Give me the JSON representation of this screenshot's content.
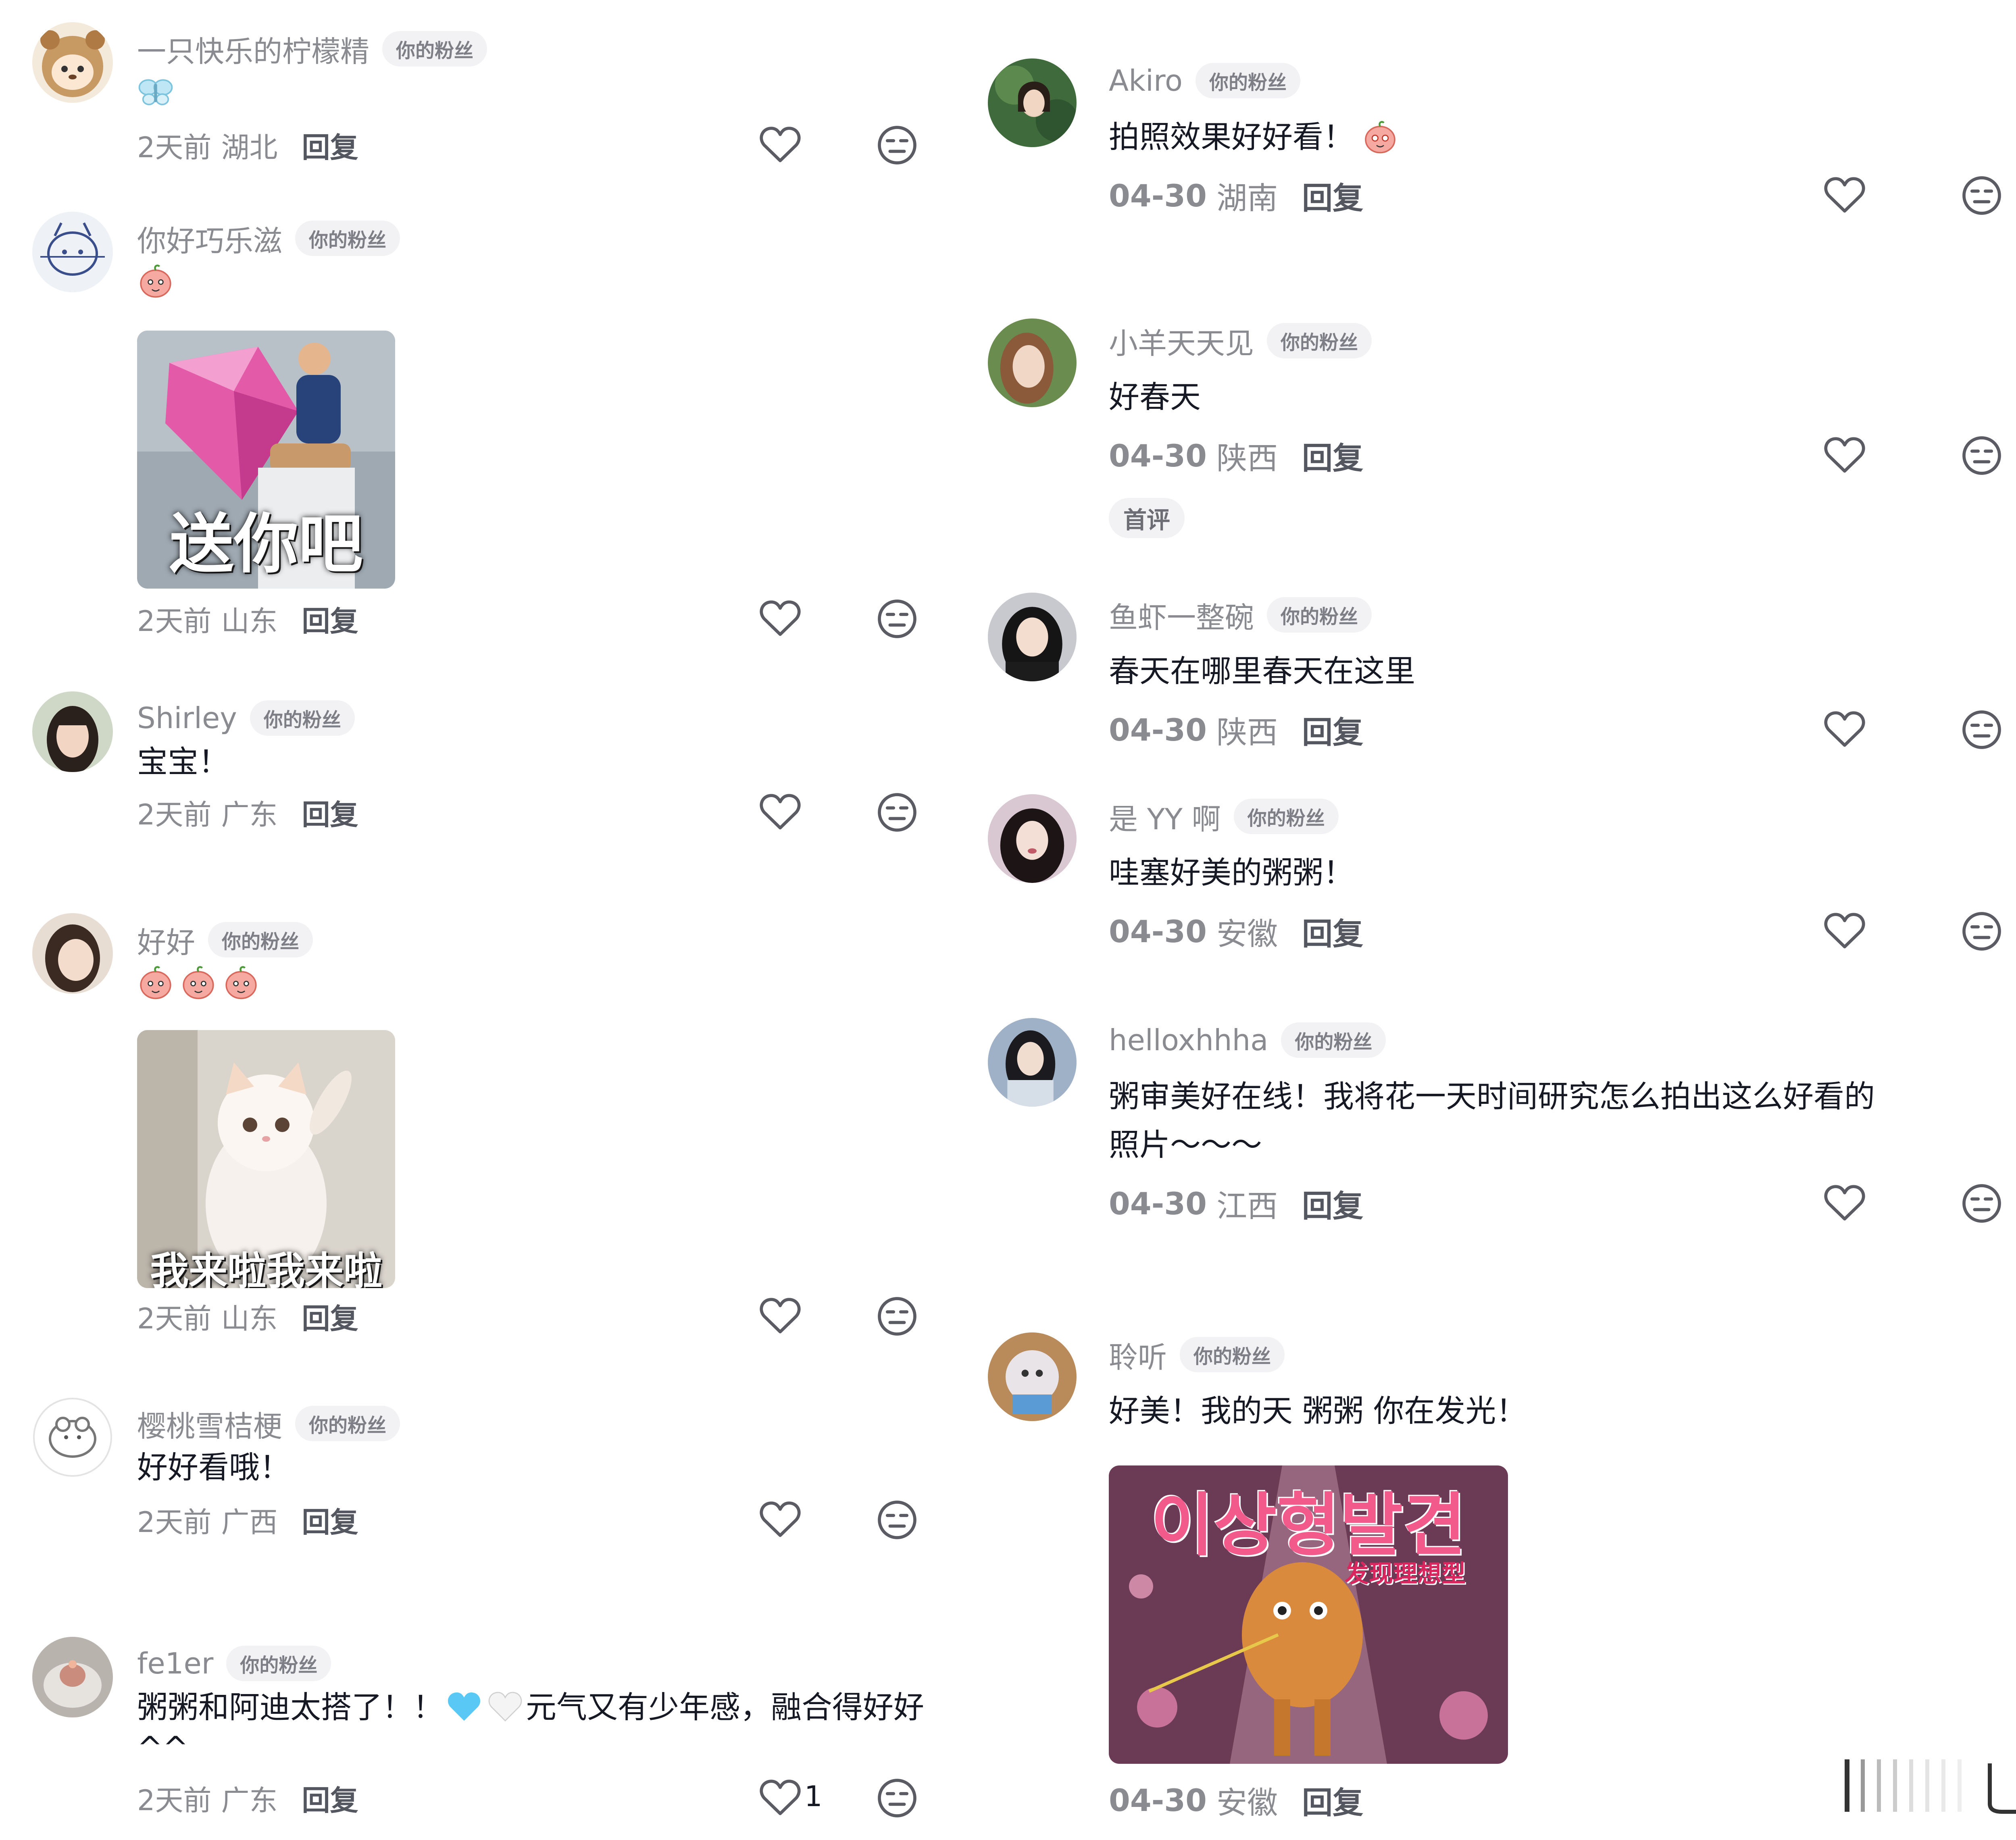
{
  "colors": {
    "meta_gray": "#8a8b91",
    "badge_bg": "#f2f2f4",
    "text_dark": "#161823",
    "icon_stroke": "#5a5b63"
  },
  "icons": {
    "like": "heart-outline-icon",
    "dislike": "neutral-face-icon",
    "scroll": "scroll-indicator-icon"
  },
  "left_comments": [
    {
      "name": "一只快乐的柠檬精",
      "badge": "你的粉丝",
      "emoji": [
        "butterfly-emoji"
      ],
      "time": "2天前",
      "location": "湖北",
      "reply": "回复"
    },
    {
      "name": "你好巧乐滋",
      "badge": "你的粉丝",
      "emoji": [
        "peach-emoji"
      ],
      "sticker_caption": "送你吧",
      "time": "2天前",
      "location": "山东",
      "reply": "回复"
    },
    {
      "name": "Shirley",
      "badge": "你的粉丝",
      "text": "宝宝！",
      "time": "2天前",
      "location": "广东",
      "reply": "回复"
    },
    {
      "name": "好好",
      "badge": "你的粉丝",
      "emoji": [
        "peach-emoji",
        "peach-emoji",
        "peach-emoji"
      ],
      "sticker_caption": "我来啦我来啦",
      "time": "2天前",
      "location": "山东",
      "reply": "回复"
    },
    {
      "name": "樱桃雪桔梗",
      "badge": "你的粉丝",
      "text": "好好看哦！",
      "time": "2天前",
      "location": "广西",
      "reply": "回复"
    },
    {
      "name": "fe1er",
      "badge": "你的粉丝",
      "text_a": "粥粥和阿迪太搭了！！",
      "text_b": "元气又有少年感，融合得好好",
      "text_c": "^^",
      "time": "2天前",
      "location": "广东",
      "reply": "回复",
      "likes": "1"
    }
  ],
  "right_comments": [
    {
      "name": "Akiro",
      "badge": "你的粉丝",
      "text": "拍照效果好好看！",
      "time": "04-30",
      "location": "湖南",
      "reply": "回复"
    },
    {
      "name": "小羊天天见",
      "badge": "你的粉丝",
      "text": "好春天",
      "time": "04-30",
      "location": "陕西",
      "reply": "回复",
      "first_badge": "首评"
    },
    {
      "name": "鱼虾一整碗",
      "badge": "你的粉丝",
      "text": "春天在哪里春天在这里",
      "time": "04-30",
      "location": "陕西",
      "reply": "回复"
    },
    {
      "name": "是 YY 啊",
      "badge": "你的粉丝",
      "text": "哇塞好美的粥粥！",
      "time": "04-30",
      "location": "安徽",
      "reply": "回复"
    },
    {
      "name": "helloxhhha",
      "badge": "你的粉丝",
      "text": "粥审美好在线！我将花一天时间研究怎么拍出这么好看的",
      "text2": "照片～～～",
      "time": "04-30",
      "location": "江西",
      "reply": "回复"
    },
    {
      "name": "聆听",
      "badge": "你的粉丝",
      "text": "好美！我的天 粥粥 你在发光！",
      "sticker_title": "이상형발견",
      "sticker_subtitle": "发现理想型",
      "time": "04-30",
      "location": "安徽",
      "reply": "回复"
    }
  ]
}
